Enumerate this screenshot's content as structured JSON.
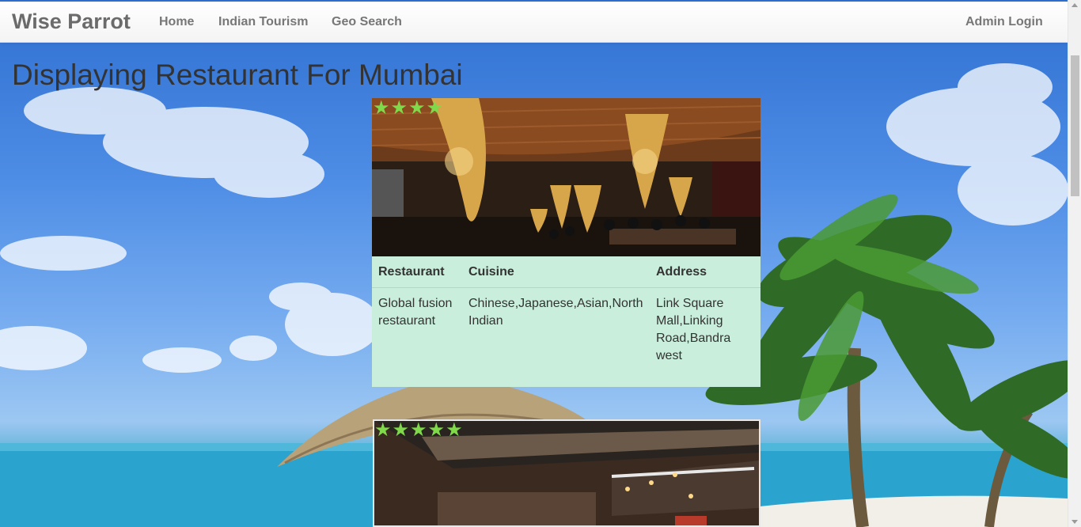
{
  "navbar": {
    "brand": "Wise Parrot",
    "links": [
      "Home",
      "Indian Tourism",
      "Geo Search"
    ],
    "admin": "Admin Login"
  },
  "page": {
    "title": "Displaying Restaurant For Mumbai"
  },
  "restaurants": [
    {
      "rating": 4,
      "headers": {
        "restaurant": "Restaurant",
        "cuisine": "Cuisine",
        "address": "Address"
      },
      "name": "Global fusion restaurant",
      "cuisine": "Chinese,Japanese,Asian,North Indian",
      "address": "Link Square Mall,Linking Road,Bandra west"
    },
    {
      "rating": 5
    }
  ],
  "colors": {
    "star": "#7fd94a",
    "info_bg": "#c9eedc"
  }
}
